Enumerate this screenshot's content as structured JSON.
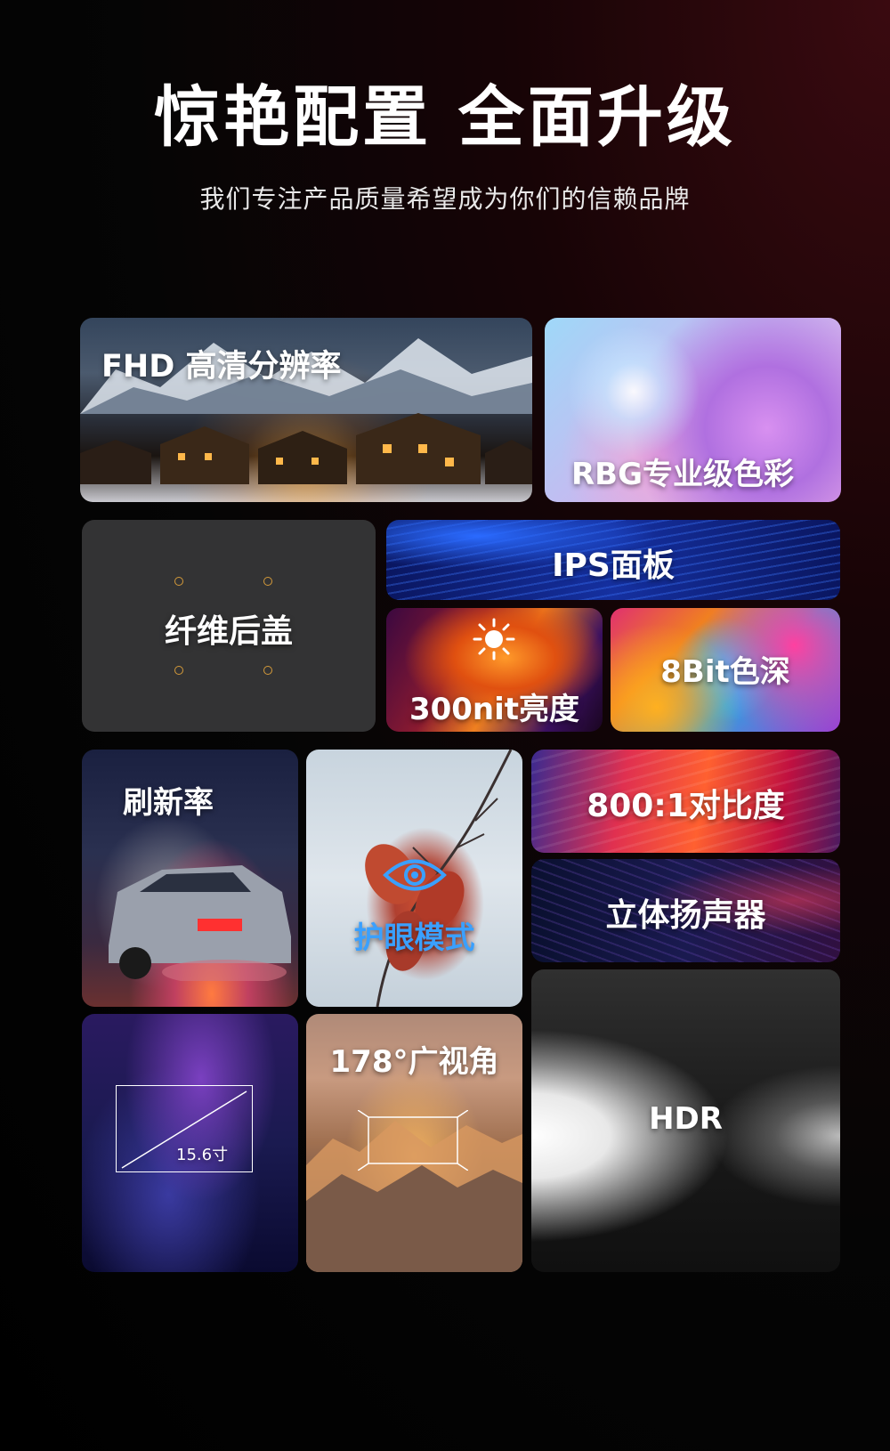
{
  "header": {
    "title": "惊艳配置 全面升级",
    "subtitle": "我们专注产品质量希望成为你们的信赖品牌"
  },
  "features": {
    "fhd": "FHD 高清分辨率",
    "rbg": "RBG专业级色彩",
    "fiber": "纤维后盖",
    "ips": "IPS面板",
    "nit": "300nit亮度",
    "bit": "8Bit色深",
    "refresh": "刷新率",
    "eye": "护眼模式",
    "contrast": "800:1对比度",
    "speaker": "立体扬声器",
    "size": "15.6寸",
    "angle": "178°广视角",
    "hdr": "HDR"
  },
  "icons": {
    "sun": "sun-icon",
    "eye": "eye-icon",
    "accent": "#d49a3a",
    "eye_color": "#3aa0ff"
  }
}
